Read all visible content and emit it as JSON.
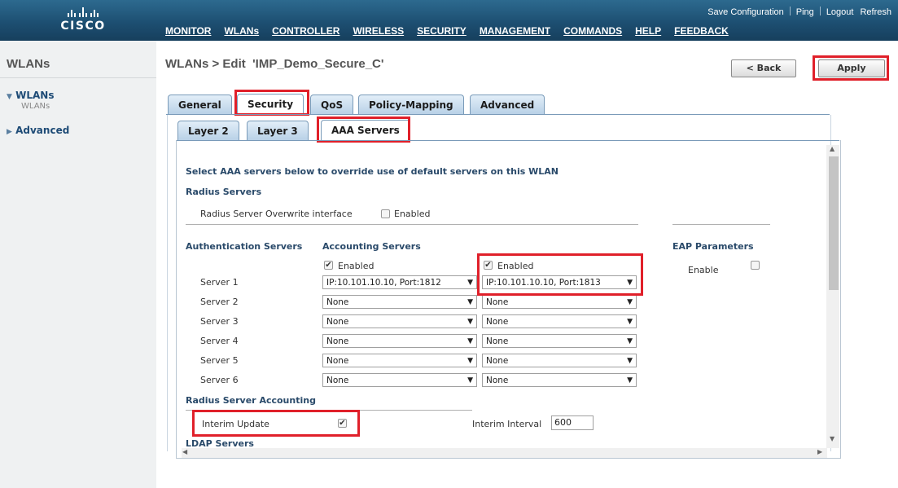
{
  "header": {
    "brand": "cisco",
    "top_links": [
      "Save Configuration",
      "Ping",
      "Logout",
      "Refresh"
    ],
    "nav": [
      "MONITOR",
      "WLANs",
      "CONTROLLER",
      "WIRELESS",
      "SECURITY",
      "MANAGEMENT",
      "COMMANDS",
      "HELP",
      "FEEDBACK"
    ]
  },
  "sidebar": {
    "title": "WLANs",
    "items": [
      {
        "label": "WLANs",
        "icon": "triangle-down",
        "sub": "WLANs"
      },
      {
        "label": "Advanced",
        "icon": "triangle-right"
      }
    ]
  },
  "page": {
    "title": "WLANs > Edit  'IMP_Demo_Secure_C'",
    "back_button": "< Back",
    "apply_button": "Apply"
  },
  "tabs": [
    "General",
    "Security",
    "QoS",
    "Policy-Mapping",
    "Advanced"
  ],
  "subtabs": [
    "Layer 2",
    "Layer 3",
    "AAA Servers"
  ],
  "aaa": {
    "intro": "Select AAA servers below to override use of default servers on this WLAN",
    "radius_heading": "Radius Servers",
    "overwrite_label": "Radius Server Overwrite interface",
    "overwrite_enabled": "Enabled",
    "auth_heading": "Authentication Servers",
    "acct_heading": "Accounting Servers",
    "eap_heading": "EAP Parameters",
    "eap_enable_label": "Enable",
    "auth_enabled_label": "Enabled",
    "acct_enabled_label": "Enabled",
    "servers": [
      {
        "label": "Server 1",
        "auth": "IP:10.101.10.10, Port:1812",
        "acct": "IP:10.101.10.10, Port:1813"
      },
      {
        "label": "Server 2",
        "auth": "None",
        "acct": "None"
      },
      {
        "label": "Server 3",
        "auth": "None",
        "acct": "None"
      },
      {
        "label": "Server 4",
        "auth": "None",
        "acct": "None"
      },
      {
        "label": "Server 5",
        "auth": "None",
        "acct": "None"
      },
      {
        "label": "Server 6",
        "auth": "None",
        "acct": "None"
      }
    ],
    "accounting_heading": "Radius Server Accounting",
    "interim_update_label": "Interim Update",
    "interim_interval_label": "Interim Interval",
    "interim_interval_value": "600",
    "ldap_heading": "LDAP Servers"
  },
  "colors": {
    "header": "#1d4f72",
    "highlight": "#e0202a",
    "tab": "#b7d0e6"
  }
}
